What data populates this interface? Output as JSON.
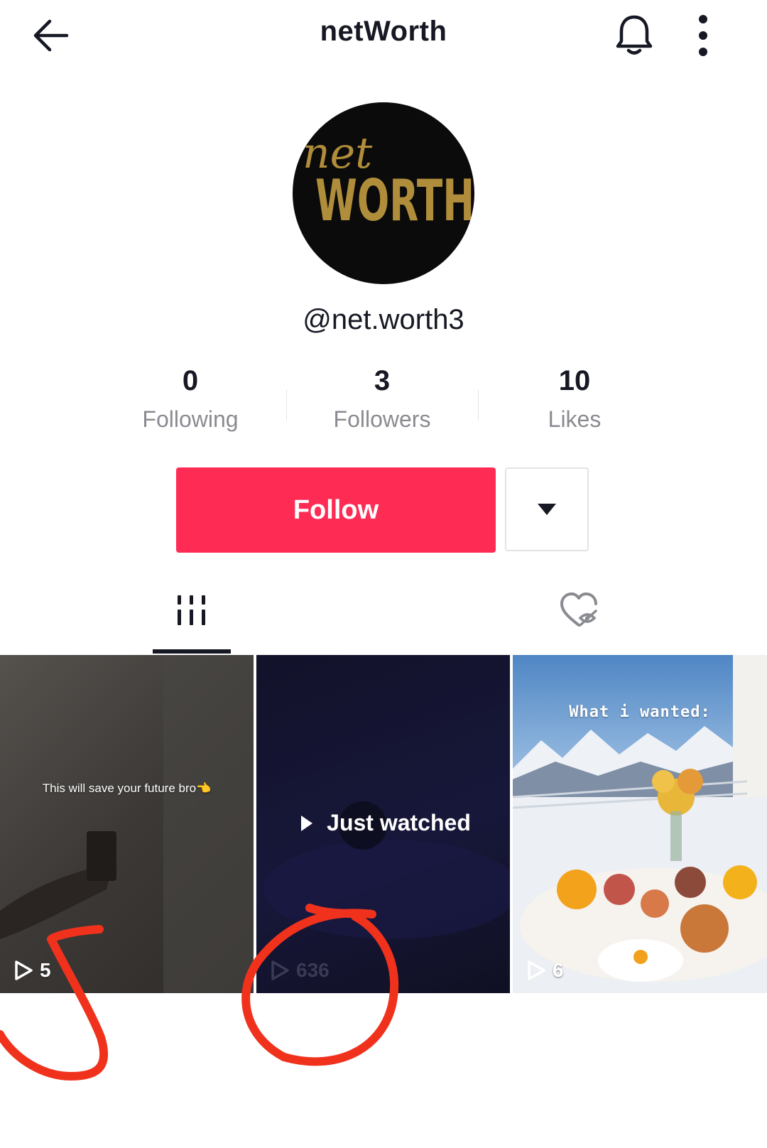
{
  "header": {
    "title": "netWorth",
    "icons": [
      "back-arrow-icon",
      "bell-icon",
      "more-vertical-icon"
    ]
  },
  "profile": {
    "avatar_text_top": "net",
    "avatar_text_bottom": "WORTH",
    "handle": "@net.worth3"
  },
  "stats": [
    {
      "value": "0",
      "label": "Following"
    },
    {
      "value": "3",
      "label": "Followers"
    },
    {
      "value": "10",
      "label": "Likes"
    }
  ],
  "actions": {
    "follow_label": "Follow"
  },
  "tabs": [
    {
      "icon": "video-grid-icon",
      "active": true
    },
    {
      "icon": "liked-hidden-icon",
      "active": false
    }
  ],
  "videos": [
    {
      "caption": "This will save your future bro👈",
      "views": "5"
    },
    {
      "overlay": "Just watched",
      "views": "636"
    },
    {
      "caption": "What i wanted:",
      "views": "6"
    }
  ],
  "colors": {
    "accent": "#fe2c55",
    "text": "#161823",
    "muted": "#8a8b91",
    "annotation": "#f0321d",
    "avatar_gold": "#b08d3a"
  }
}
